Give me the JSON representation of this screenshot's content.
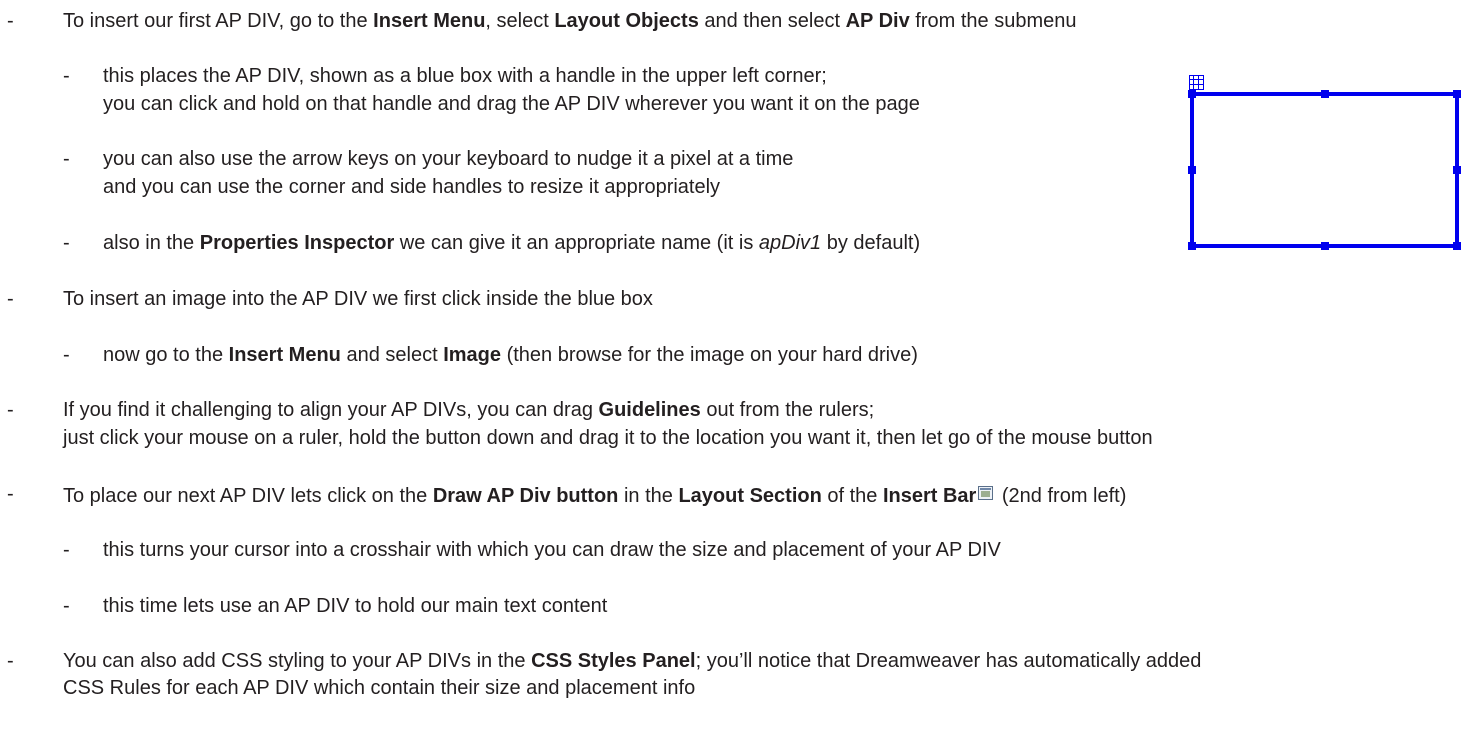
{
  "bullets": {
    "b1": {
      "dash": "-",
      "t1": "To insert our first AP DIV, go to the ",
      "b1": "Insert Menu",
      "t2": ", select ",
      "b2": "Layout Objects",
      "t3": " and then select ",
      "b3": "AP Div",
      "t4": " from the submenu"
    },
    "b2": {
      "dash": "-",
      "line1": "this places the AP DIV, shown as a blue box with a handle in the upper left corner;",
      "line2": "you can click and hold on that handle and drag the AP DIV wherever you want it on the page"
    },
    "b3": {
      "dash": "-",
      "line1": "you can also use the arrow keys on your keyboard to nudge it a pixel at a time",
      "line2": "and you can use the corner and side handles to resize it appropriately"
    },
    "b4": {
      "dash": "-",
      "t1": "also in the ",
      "b1": "Properties Inspector",
      "t2": " we can give it an appropriate name (it is ",
      "i1": "apDiv1",
      "t3": " by default)"
    },
    "b5": {
      "dash": "-",
      "text": "To insert an image into the AP DIV we first click inside the blue box"
    },
    "b6": {
      "dash": "-",
      "t1": "now go to the ",
      "b1": "Insert Menu",
      "t2": " and select ",
      "b2": "Image",
      "t3": " (then browse for the image on your hard drive)"
    },
    "b7": {
      "dash": "-",
      "t1": "If you find it challenging to align your AP DIVs, you can drag ",
      "b1": "Guidelines",
      "t2": " out from the rulers;",
      "line2": "just click your mouse on a ruler, hold the button down and drag it to the location you want it, then let go of the mouse button"
    },
    "b8": {
      "dash": "-",
      "t1": "To place our next AP DIV lets click on the ",
      "b1": "Draw AP Div button",
      "t2": " in the ",
      "b2": "Layout Section",
      "t3": " of the ",
      "b3": "Insert Bar",
      "t4": " (2nd from left)"
    },
    "b9": {
      "dash": "-",
      "text": "this turns your cursor into a crosshair with which you can draw the size and placement of your AP DIV"
    },
    "b10": {
      "dash": "-",
      "text": "this time lets use an AP DIV to hold our main text content"
    },
    "b11": {
      "dash": "-",
      "t1": "You can also add CSS styling to your AP DIVs in the ",
      "b1": "CSS Styles Panel",
      "t2": "; you’ll notice that Dreamweaver has automatically added",
      "line2": "CSS Rules for each AP DIV which contain their size and placement info"
    }
  },
  "colors": {
    "text": "#231f20",
    "apdiv_border": "#0000ee"
  },
  "icons": {
    "apdiv_handle": "apdiv-handle-icon",
    "insert_bar_button": "draw-ap-div-icon"
  }
}
